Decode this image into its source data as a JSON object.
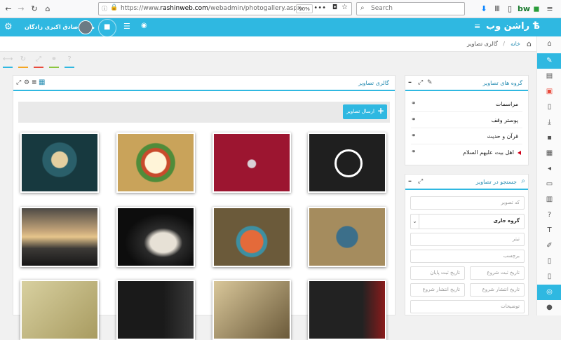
{
  "browser": {
    "url_prefix": "https://www.",
    "url_domain": "rashinweb.com",
    "url_path": "/webadmin/photogallery.aspx",
    "zoom": "90%",
    "search_placeholder": "Search"
  },
  "header": {
    "user_name": "محمد صادق اکبری زادگان",
    "logo_text": "راشن وب"
  },
  "breadcrumb": {
    "home": "خانه",
    "separator": "/",
    "current": "گالری تصاویر"
  },
  "gallery": {
    "title": "گالری تصاویر",
    "send_button": "ارسال تصاویر"
  },
  "groups": {
    "title": "گروه های تصاویر",
    "items": [
      "مراسمات",
      "پوستر وقف",
      "قرآن و حدیث",
      "اهل بیت علیهم السلام"
    ]
  },
  "search": {
    "title": "جستجو در تصاویر",
    "code_placeholder": "کد تصویر",
    "group_value": "گروه جاری",
    "title_placeholder": "تیتر",
    "label_placeholder": "برچسب",
    "reg_start": "تاریخ ثبت شروع",
    "reg_end": "تاریخ ثبت پایان",
    "pub_start": "تاریخ انتشار شروع",
    "pub_end": "تاریخ انتشار شروع",
    "description": "توضیحات"
  },
  "colors": {
    "accent": "#2fb8e1",
    "active_group_marker": "#d0021b"
  }
}
